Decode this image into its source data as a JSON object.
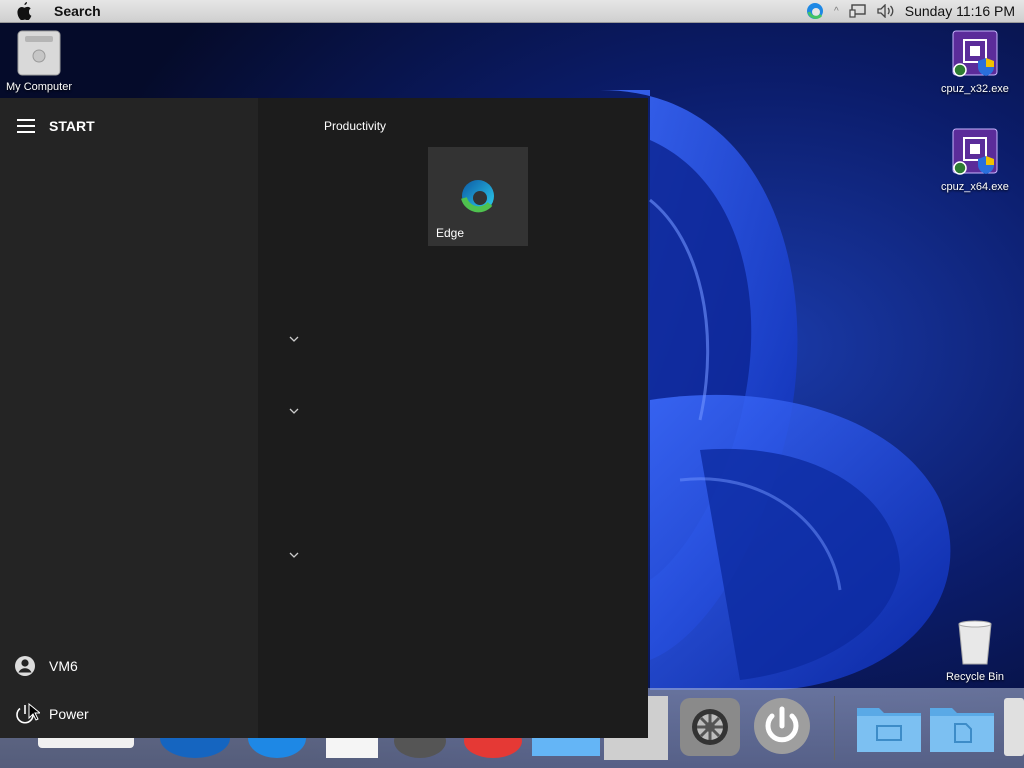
{
  "menubar": {
    "search_label": "Search",
    "clock": "Sunday 11:16 PM"
  },
  "desktop": {
    "my_computer": "My Computer",
    "cpuz32": "cpuz_x32.exe",
    "cpuz64": "cpuz_x64.exe",
    "recycle_bin": "Recycle Bin"
  },
  "start_menu": {
    "title": "START",
    "user": "VM6",
    "power": "Power",
    "group": "Productivity",
    "tile_edge": "Edge"
  },
  "colors": {
    "menu_bg": "#242424",
    "tiles_bg": "#1c1c1c",
    "tile": "#333333"
  }
}
